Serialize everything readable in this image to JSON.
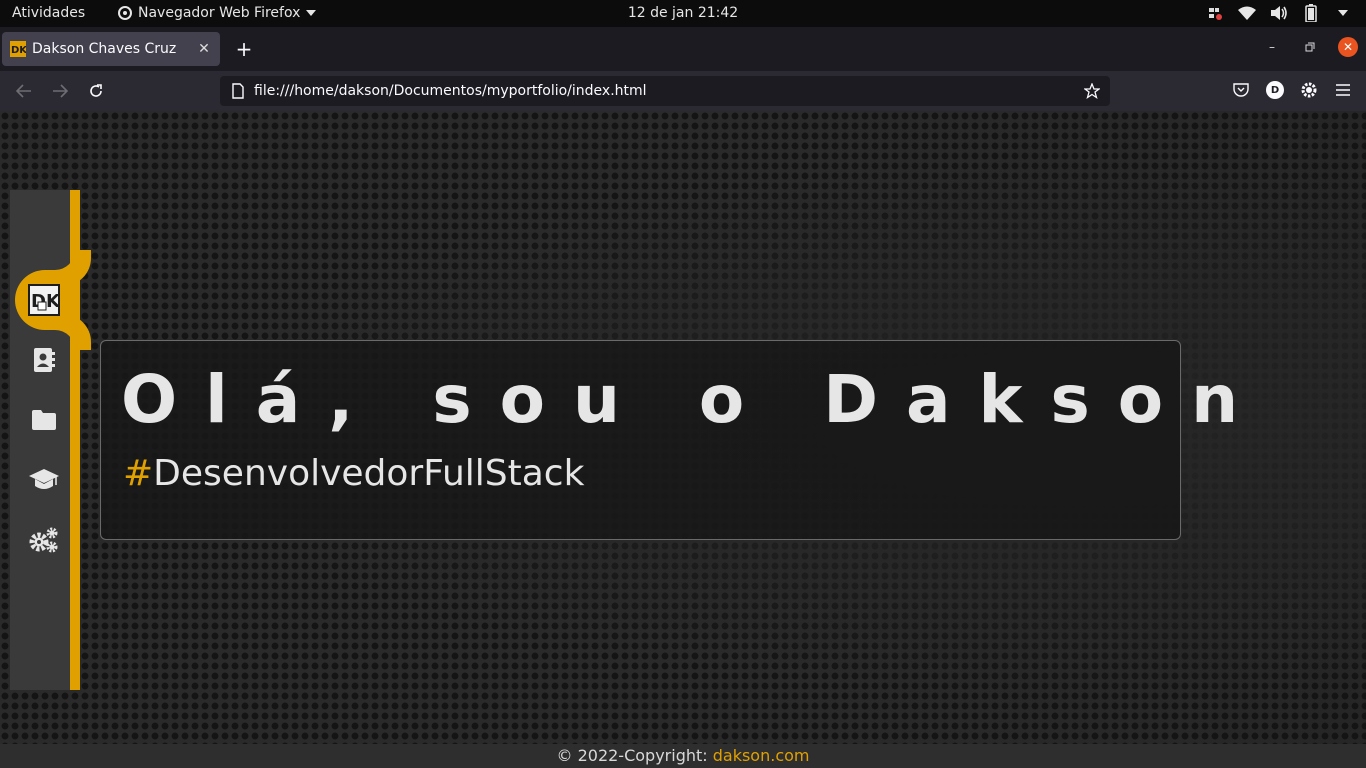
{
  "system": {
    "activities": "Atividades",
    "app_menu": "Navegador Web Firefox",
    "clock": "12 de jan  21:42"
  },
  "browser": {
    "tab_title": "Dakson Chaves Cruz",
    "url": "file:///home/dakson/Documentos/myportfolio/index.html",
    "account_initial": "D"
  },
  "page": {
    "hero_title": "Olá, sou o Dakson",
    "hero_hash": "#",
    "hero_subtitle": "DesenvolvedorFullStack",
    "footer_text": "© 2022-Copyright: ",
    "footer_link": "dakson.com",
    "accent_color": "#e0a100",
    "sidebar_icons": [
      "dk-logo-icon",
      "contact-card-icon",
      "folder-icon",
      "graduation-cap-icon",
      "gears-icon"
    ]
  }
}
